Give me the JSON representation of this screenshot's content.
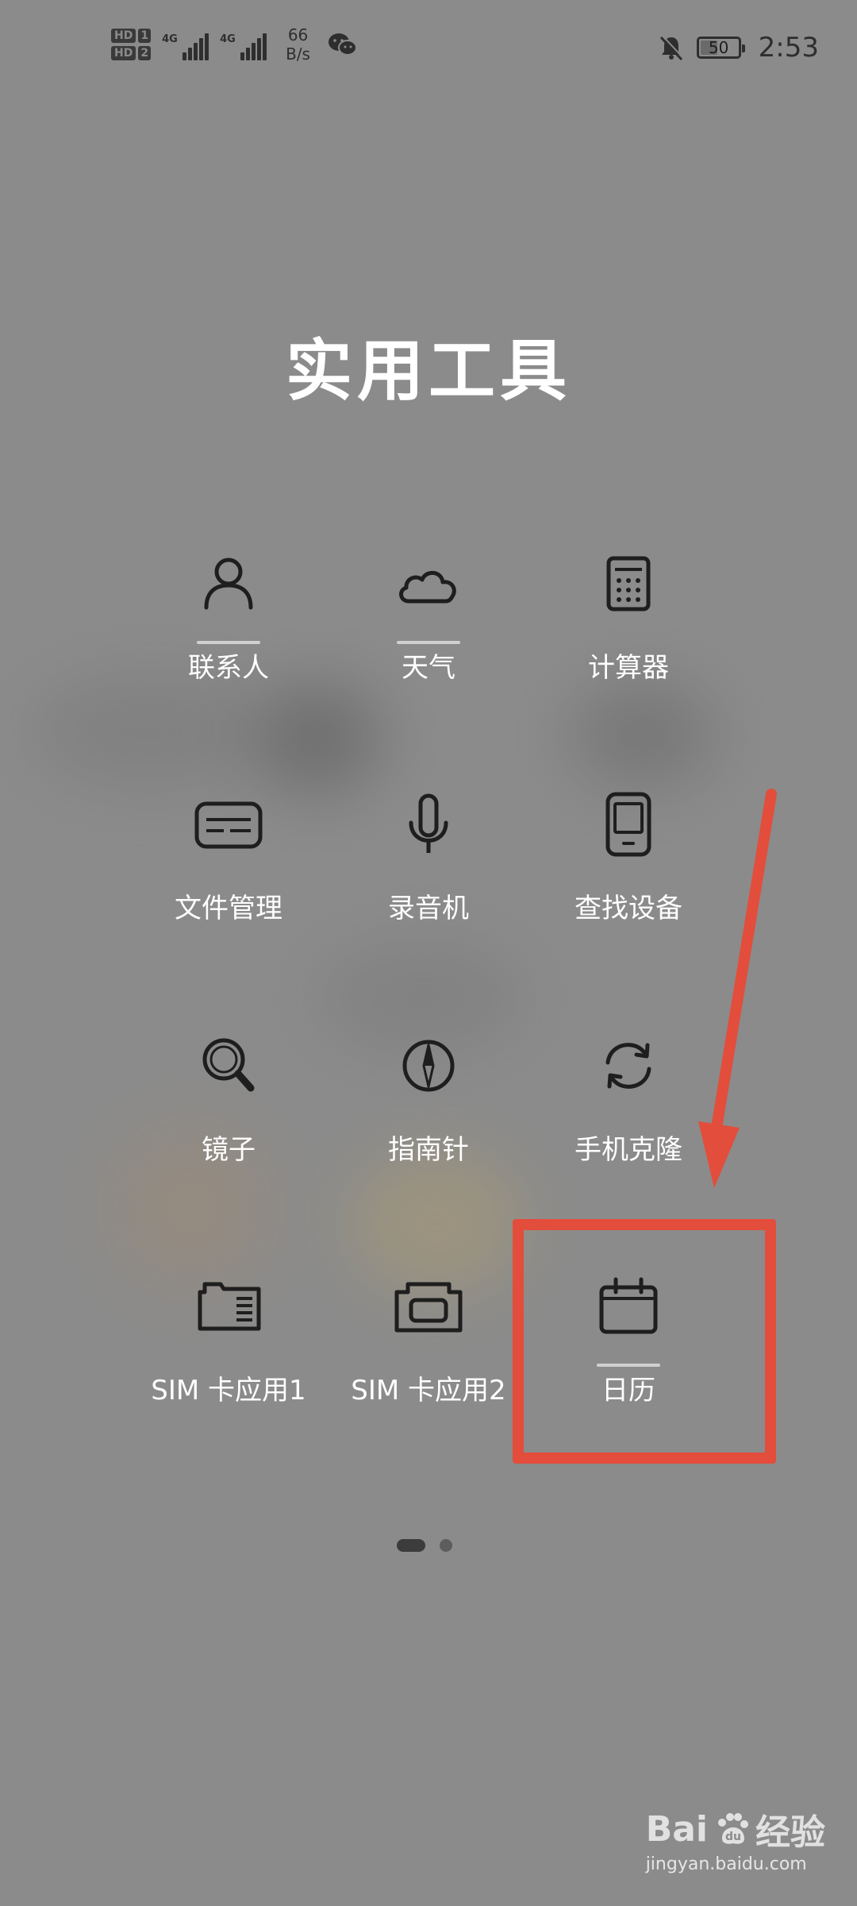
{
  "status_bar": {
    "hd1": "HD",
    "hd1_num": "1",
    "hd2": "HD",
    "hd2_num": "2",
    "signal1_tag": "4G",
    "signal2_tag": "4G",
    "net_speed_value": "66",
    "net_speed_unit": "B/s",
    "battery": "50",
    "battery_level": 0.5,
    "time": "2:53"
  },
  "title": "实用工具",
  "apps": [
    {
      "label": "联系人",
      "icon": "person-icon"
    },
    {
      "label": "天气",
      "icon": "cloud-icon"
    },
    {
      "label": "计算器",
      "icon": "calculator-icon"
    },
    {
      "label": "文件管理",
      "icon": "file-manager-icon"
    },
    {
      "label": "录音机",
      "icon": "microphone-icon"
    },
    {
      "label": "查找设备",
      "icon": "find-device-icon"
    },
    {
      "label": "镜子",
      "icon": "magnifier-mirror-icon"
    },
    {
      "label": "指南针",
      "icon": "compass-icon"
    },
    {
      "label": "手机克隆",
      "icon": "phone-clone-icon"
    },
    {
      "label": "SIM 卡应用1",
      "icon": "sim-card-icon"
    },
    {
      "label": "SIM 卡应用2",
      "icon": "sim-card-2-icon"
    },
    {
      "label": "日历",
      "icon": "calendar-icon"
    }
  ],
  "pager": {
    "pages": 2,
    "current": 1
  },
  "watermark": {
    "logo_text": "Bai",
    "logo_text2": "经验",
    "url": "jingyan.baidu.com"
  },
  "colors": {
    "background": "#8b8b8b",
    "highlight": "#e34d3c",
    "icon_stroke": "#1e1e1e"
  }
}
